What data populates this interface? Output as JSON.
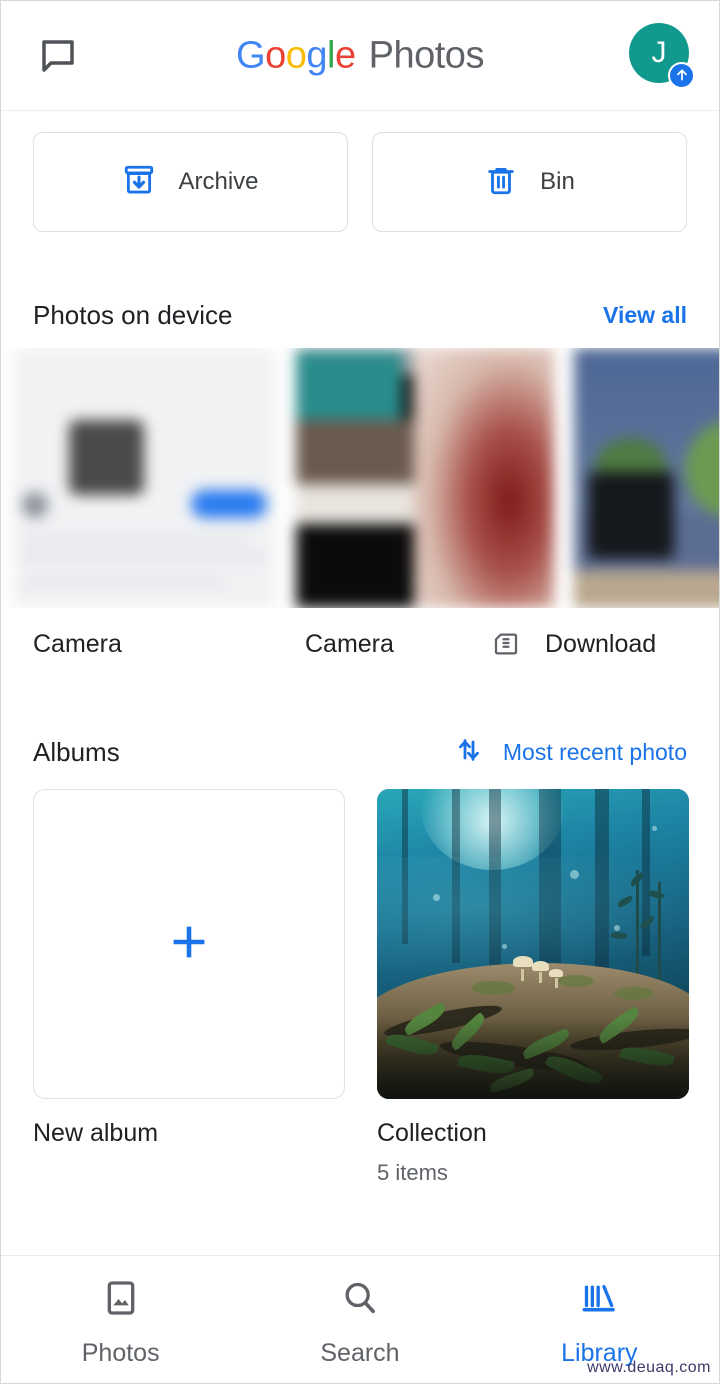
{
  "header": {
    "chat_icon": "chat-bubble-icon",
    "logo": {
      "g1": "G",
      "o1": "o",
      "o2": "o",
      "g2": "g",
      "l": "l",
      "e": "e",
      "product": "Photos",
      "colors": {
        "blue": "#4285F4",
        "red": "#EA4335",
        "yellow": "#FBBC05",
        "green": "#34A853",
        "product_gray": "#5f6368"
      }
    },
    "avatar": {
      "initial": "J",
      "background": "#11998e",
      "badge_icon": "upload-arrow-icon",
      "badge_color": "#1a73e8"
    }
  },
  "quick_actions": [
    {
      "label": "Archive",
      "icon": "archive-box-down-arrow-icon",
      "color": "#1a73e8"
    },
    {
      "label": "Bin",
      "icon": "trash-bin-icon",
      "color": "#1a73e8"
    }
  ],
  "device_section": {
    "title": "Photos on device",
    "action_label": "View all",
    "action_color": "#1a73e8",
    "folders": [
      {
        "label": "Camera",
        "icon": null
      },
      {
        "label": "Camera",
        "icon": null
      },
      {
        "label": "Download",
        "icon": "sd-card-icon"
      }
    ]
  },
  "albums_section": {
    "title": "Albums",
    "sort_icon": "sort-arrows-icon",
    "sort_label": "Most recent photo",
    "sort_color": "#1a73e8",
    "items": [
      {
        "name": "New album",
        "subtitle": null,
        "icon": "plus-icon",
        "type": "create"
      },
      {
        "name": "Collection",
        "subtitle": "5 items",
        "type": "album"
      }
    ]
  },
  "bottom_nav": {
    "active": "Library",
    "items": [
      {
        "label": "Photos",
        "icon": "image-photo-icon",
        "active": false
      },
      {
        "label": "Search",
        "icon": "magnifier-search-icon",
        "active": true
      },
      {
        "label": "Library",
        "icon": "library-books-icon",
        "active": true
      }
    ],
    "active_color": "#1a73e8",
    "inactive_color": "#5f6368"
  },
  "watermark": "www.deuaq.com"
}
